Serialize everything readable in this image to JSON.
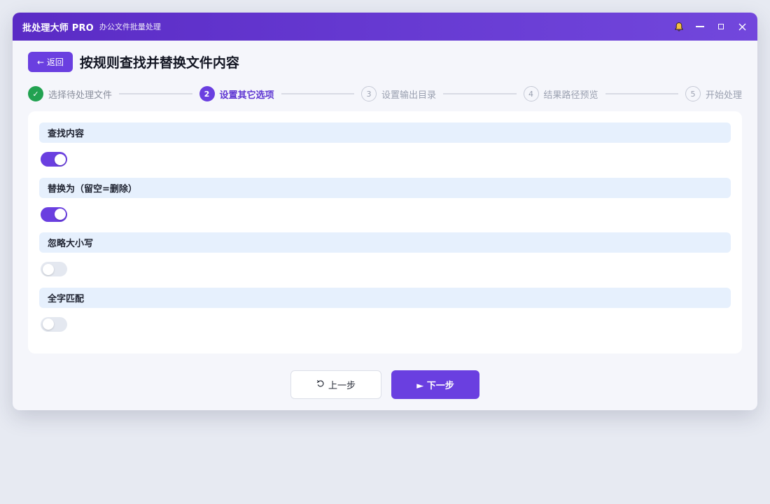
{
  "titlebar": {
    "app_name": "批处理大师 PRO",
    "app_subtitle": "办公文件批量处理",
    "icons": [
      "bell-icon",
      "minimize-icon",
      "maximize-icon",
      "close-icon"
    ]
  },
  "header": {
    "back_label": "← 返回",
    "page_title": "按规则查找并替换文件内容"
  },
  "stepper": {
    "steps": [
      {
        "number": "✓",
        "label": "选择待处理文件",
        "state": "done"
      },
      {
        "number": "2",
        "label": "设置其它选项",
        "state": "active"
      },
      {
        "number": "3",
        "label": "设置输出目录",
        "state": "todo"
      },
      {
        "number": "4",
        "label": "结果路径预览",
        "state": "todo"
      },
      {
        "number": "5",
        "label": "开始处理",
        "state": "todo"
      }
    ]
  },
  "options": [
    {
      "label": "查找内容",
      "enabled": true
    },
    {
      "label": "替换为（留空=删除）",
      "enabled": true
    },
    {
      "label": "忽略大小写",
      "enabled": false
    },
    {
      "label": "全字匹配",
      "enabled": false
    }
  ],
  "footer": {
    "prev_label": "上一步",
    "prev_icon": "undo-icon",
    "next_label": "► 下一步"
  },
  "colors": {
    "accent": "#6a3fe0",
    "success": "#22a251",
    "label_bg": "#e6f0fd"
  }
}
